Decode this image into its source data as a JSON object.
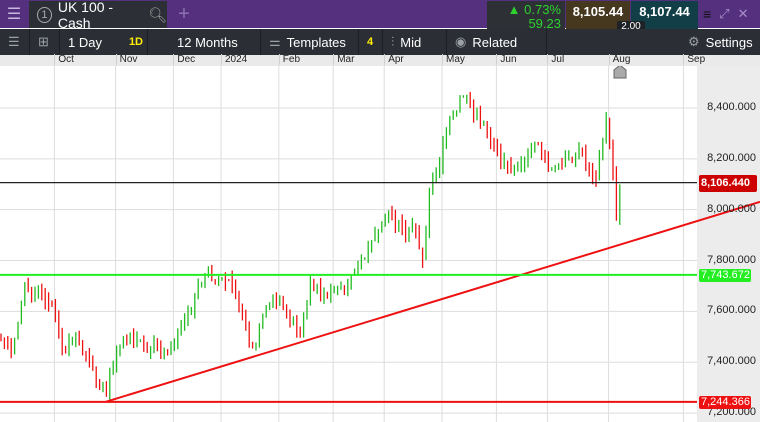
{
  "header": {
    "menu_icon": "hamburger-icon",
    "tab_number": "1",
    "instrument": "UK 100 - Cash",
    "add_tab": "+",
    "change_pct": "▲ 0.73%",
    "change_pts": "59.23",
    "bid": "8,105.44",
    "ask": "8,107.44",
    "spread": "2.00"
  },
  "toolbar": {
    "interval": "1 Day",
    "interval_badge": "1D",
    "range": "12 Months",
    "templates": "Templates",
    "templates_count": "4",
    "price_type": "Mid",
    "related": "Related",
    "settings": "Settings"
  },
  "colors": {
    "up": "#22bb22",
    "down": "#ee1111",
    "support": "#22ee22",
    "trend": "#ee1111",
    "current": "#222222"
  },
  "chart_data": {
    "type": "ohlc",
    "x_unit": "trading day index",
    "xlim": [
      0,
      205
    ],
    "ylim": [
      7165,
      8565
    ],
    "month_ticks": [
      {
        "label": "Oct",
        "x": 16
      },
      {
        "label": "Nov",
        "x": 34
      },
      {
        "label": "Dec",
        "x": 51
      },
      {
        "label": "2024",
        "x": 65
      },
      {
        "label": "Feb",
        "x": 82
      },
      {
        "label": "Mar",
        "x": 98
      },
      {
        "label": "Apr",
        "x": 113
      },
      {
        "label": "May",
        "x": 130
      },
      {
        "label": "Jun",
        "x": 146
      },
      {
        "label": "Jul",
        "x": 161
      },
      {
        "label": "Aug",
        "x": 179
      },
      {
        "label": "Sep",
        "x": 201
      }
    ],
    "y_ticks": [
      "7,200.000",
      "7,400.000",
      "7,600.000",
      "7,800.000",
      "8,000.000",
      "8,200.000",
      "8,400.000"
    ],
    "y_tick_values": [
      7200,
      7400,
      7600,
      7800,
      8000,
      8200,
      8400
    ],
    "close_path": [
      [
        0,
        7499
      ],
      [
        3,
        7438
      ],
      [
        7,
        7700
      ],
      [
        10,
        7680
      ],
      [
        15,
        7620
      ],
      [
        18,
        7458
      ],
      [
        22,
        7500
      ],
      [
        26,
        7400
      ],
      [
        31,
        7265
      ],
      [
        34,
        7458
      ],
      [
        38,
        7500
      ],
      [
        44,
        7458
      ],
      [
        49,
        7440
      ],
      [
        53,
        7540
      ],
      [
        57,
        7660
      ],
      [
        60,
        7740
      ],
      [
        65,
        7732
      ],
      [
        69,
        7680
      ],
      [
        74,
        7458
      ],
      [
        78,
        7620
      ],
      [
        82,
        7640
      ],
      [
        88,
        7500
      ],
      [
        91,
        7720
      ],
      [
        96,
        7660
      ],
      [
        101,
        7680
      ],
      [
        104,
        7760
      ],
      [
        109,
        7880
      ],
      [
        113,
        7981
      ],
      [
        118,
        7920
      ],
      [
        121,
        7940
      ],
      [
        124,
        7800
      ],
      [
        126,
        8062
      ],
      [
        129,
        8183
      ],
      [
        132,
        8364
      ],
      [
        136,
        8444
      ],
      [
        140,
        8384
      ],
      [
        144,
        8263
      ],
      [
        149,
        8163
      ],
      [
        153,
        8183
      ],
      [
        157,
        8263
      ],
      [
        162,
        8163
      ],
      [
        166,
        8203
      ],
      [
        171,
        8223
      ],
      [
        175,
        8122
      ],
      [
        178,
        8364
      ],
      [
        180,
        8142
      ],
      [
        181,
        7961
      ],
      [
        182,
        8082
      ]
    ],
    "lines": [
      {
        "name": "current-price",
        "value": 8106.44,
        "label": "8,106.440"
      },
      {
        "name": "resistance-support",
        "value": 7743.672,
        "label": "7,743.672"
      },
      {
        "name": "low-support",
        "value": 7244.366,
        "label": "7,244.366"
      }
    ],
    "trendline": {
      "from": [
        31,
        7244
      ],
      "to": [
        205,
        7955
      ]
    }
  }
}
